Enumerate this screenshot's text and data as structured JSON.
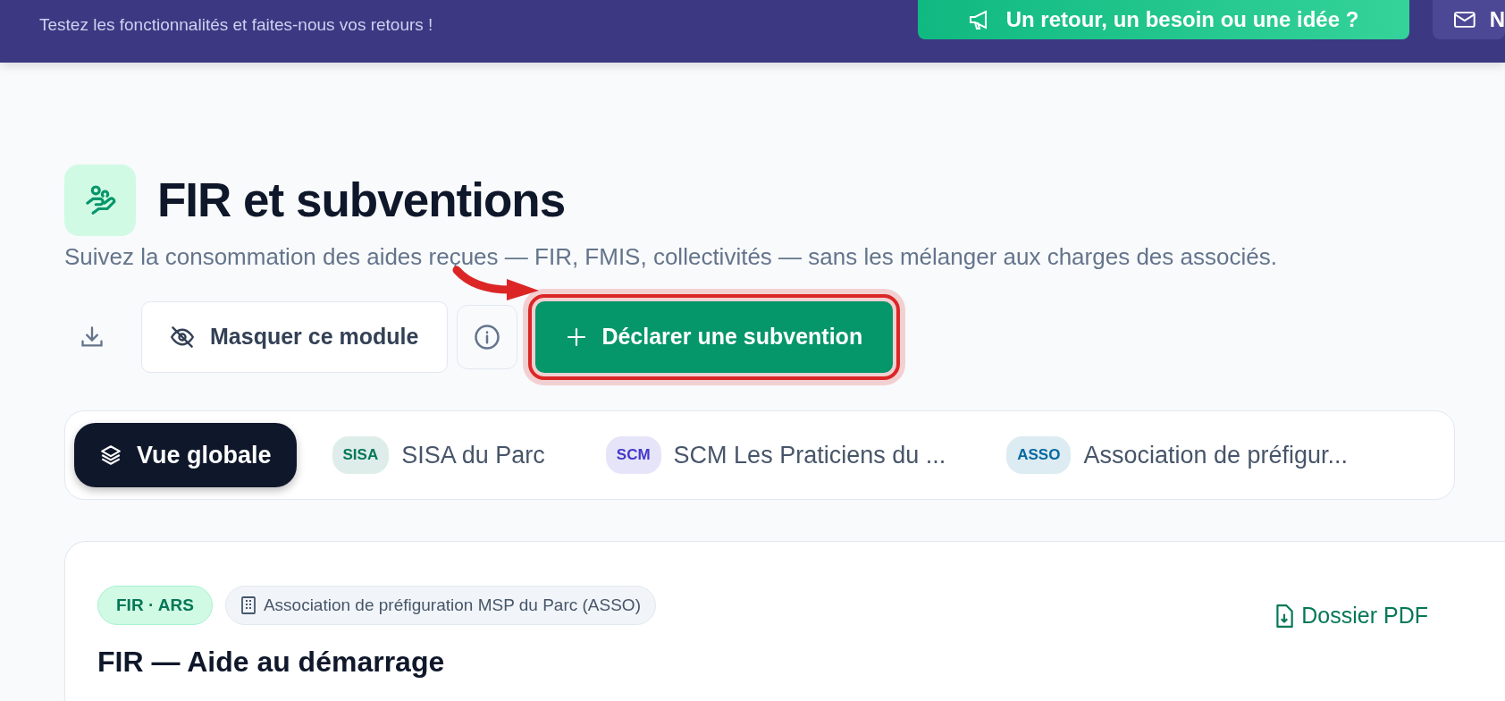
{
  "banner": {
    "message": "Testez les fonctionnalités et faites-nous vos retours !",
    "feedback_button": "Un retour, un besoin ou une idée ?",
    "mail_button": "N"
  },
  "header": {
    "title": "FIR et subventions",
    "subtitle": "Suivez la consommation des aides reçues — FIR, FMIS, collectivités — sans les mélanger aux charges des associés."
  },
  "actions": {
    "hide_button": "Masquer ce module",
    "declare_button": "Déclarer une subvention",
    "declare_highlighted": true
  },
  "tabs": [
    {
      "label": "Vue globale",
      "selected": true
    },
    {
      "tag": "SISA",
      "label": "SISA du Parc",
      "color": "#047857",
      "selected": false
    },
    {
      "tag": "SCM",
      "label": "SCM Les Praticiens du ...",
      "color": "#4338ca",
      "selected": false
    },
    {
      "tag": "ASSO",
      "label": "Association de préfigur...",
      "color": "#0369a1",
      "selected": false
    }
  ],
  "grant_card": {
    "type_badge": "FIR · ARS",
    "entity_badge": "Association de préfiguration MSP du Parc (ASSO)",
    "pdf_link": "Dossier PDF",
    "title": "FIR — Aide au démarrage"
  }
}
